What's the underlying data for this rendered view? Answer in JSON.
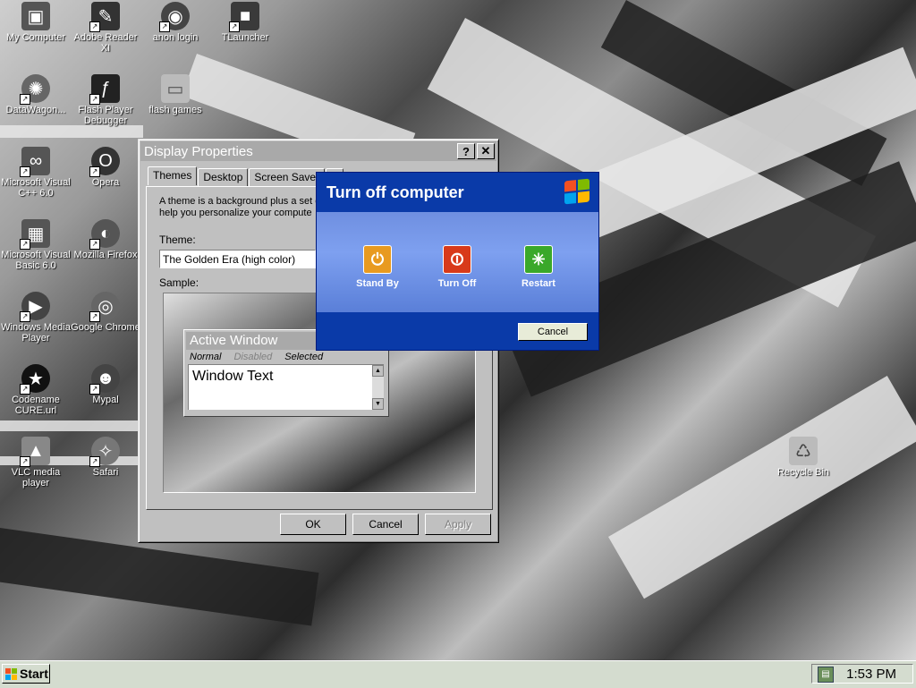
{
  "desktop": {
    "icons": [
      {
        "label": "My Computer",
        "icon": "computer-icon"
      },
      {
        "label": "Adobe Reader XI",
        "icon": "pdf-icon"
      },
      {
        "label": "anon login",
        "icon": "steam-icon"
      },
      {
        "label": "TLauncher",
        "icon": "cube-icon"
      },
      {
        "label": "DataWagon...",
        "icon": "gear-icon"
      },
      {
        "label": "Flash Player Debugger",
        "icon": "flash-icon"
      },
      {
        "label": "flash games",
        "icon": "folder-icon"
      },
      {
        "label": "Microsoft Visual C++ 6.0",
        "icon": "vcpp-icon"
      },
      {
        "label": "Opera",
        "icon": "opera-icon"
      },
      {
        "label": "Microsoft Visual Basic 6.0",
        "icon": "vb-icon"
      },
      {
        "label": "Mozilla Firefox",
        "icon": "firefox-icon"
      },
      {
        "label": "Windows Media Player",
        "icon": "media-player-icon"
      },
      {
        "label": "Google Chrome",
        "icon": "chrome-icon"
      },
      {
        "label": "Codename CURE.url",
        "icon": "url-icon"
      },
      {
        "label": "Mypal",
        "icon": "mypal-icon"
      },
      {
        "label": "VLC media player",
        "icon": "vlc-icon"
      },
      {
        "label": "Safari",
        "icon": "safari-icon"
      },
      {
        "label": "Recycle Bin",
        "icon": "recycle-bin-icon"
      }
    ]
  },
  "display_properties": {
    "title": "Display Properties",
    "help_btn": "?",
    "close_btn": "✕",
    "tabs": [
      "Themes",
      "Desktop",
      "Screen Saver",
      "A"
    ],
    "description": "A theme is a background plus a set o to help you personalize your compute",
    "theme_label": "Theme:",
    "theme_value": "The Golden Era (high color)",
    "sample_label": "Sample:",
    "sample": {
      "active_window": "Active Window",
      "menu_normal": "Normal",
      "menu_disabled": "Disabled",
      "menu_selected": "Selected",
      "window_text": "Window Text"
    },
    "ok": "OK",
    "cancel": "Cancel",
    "apply": "Apply"
  },
  "turn_off": {
    "title": "Turn off computer",
    "stand_by": "Stand By",
    "turn_off": "Turn Off",
    "restart": "Restart",
    "cancel": "Cancel",
    "colors": {
      "stand_by": "#e89a20",
      "turn_off": "#d83a1a",
      "restart": "#3aa82a"
    }
  },
  "taskbar": {
    "start_label": "Start",
    "clock": "1:53 PM"
  }
}
